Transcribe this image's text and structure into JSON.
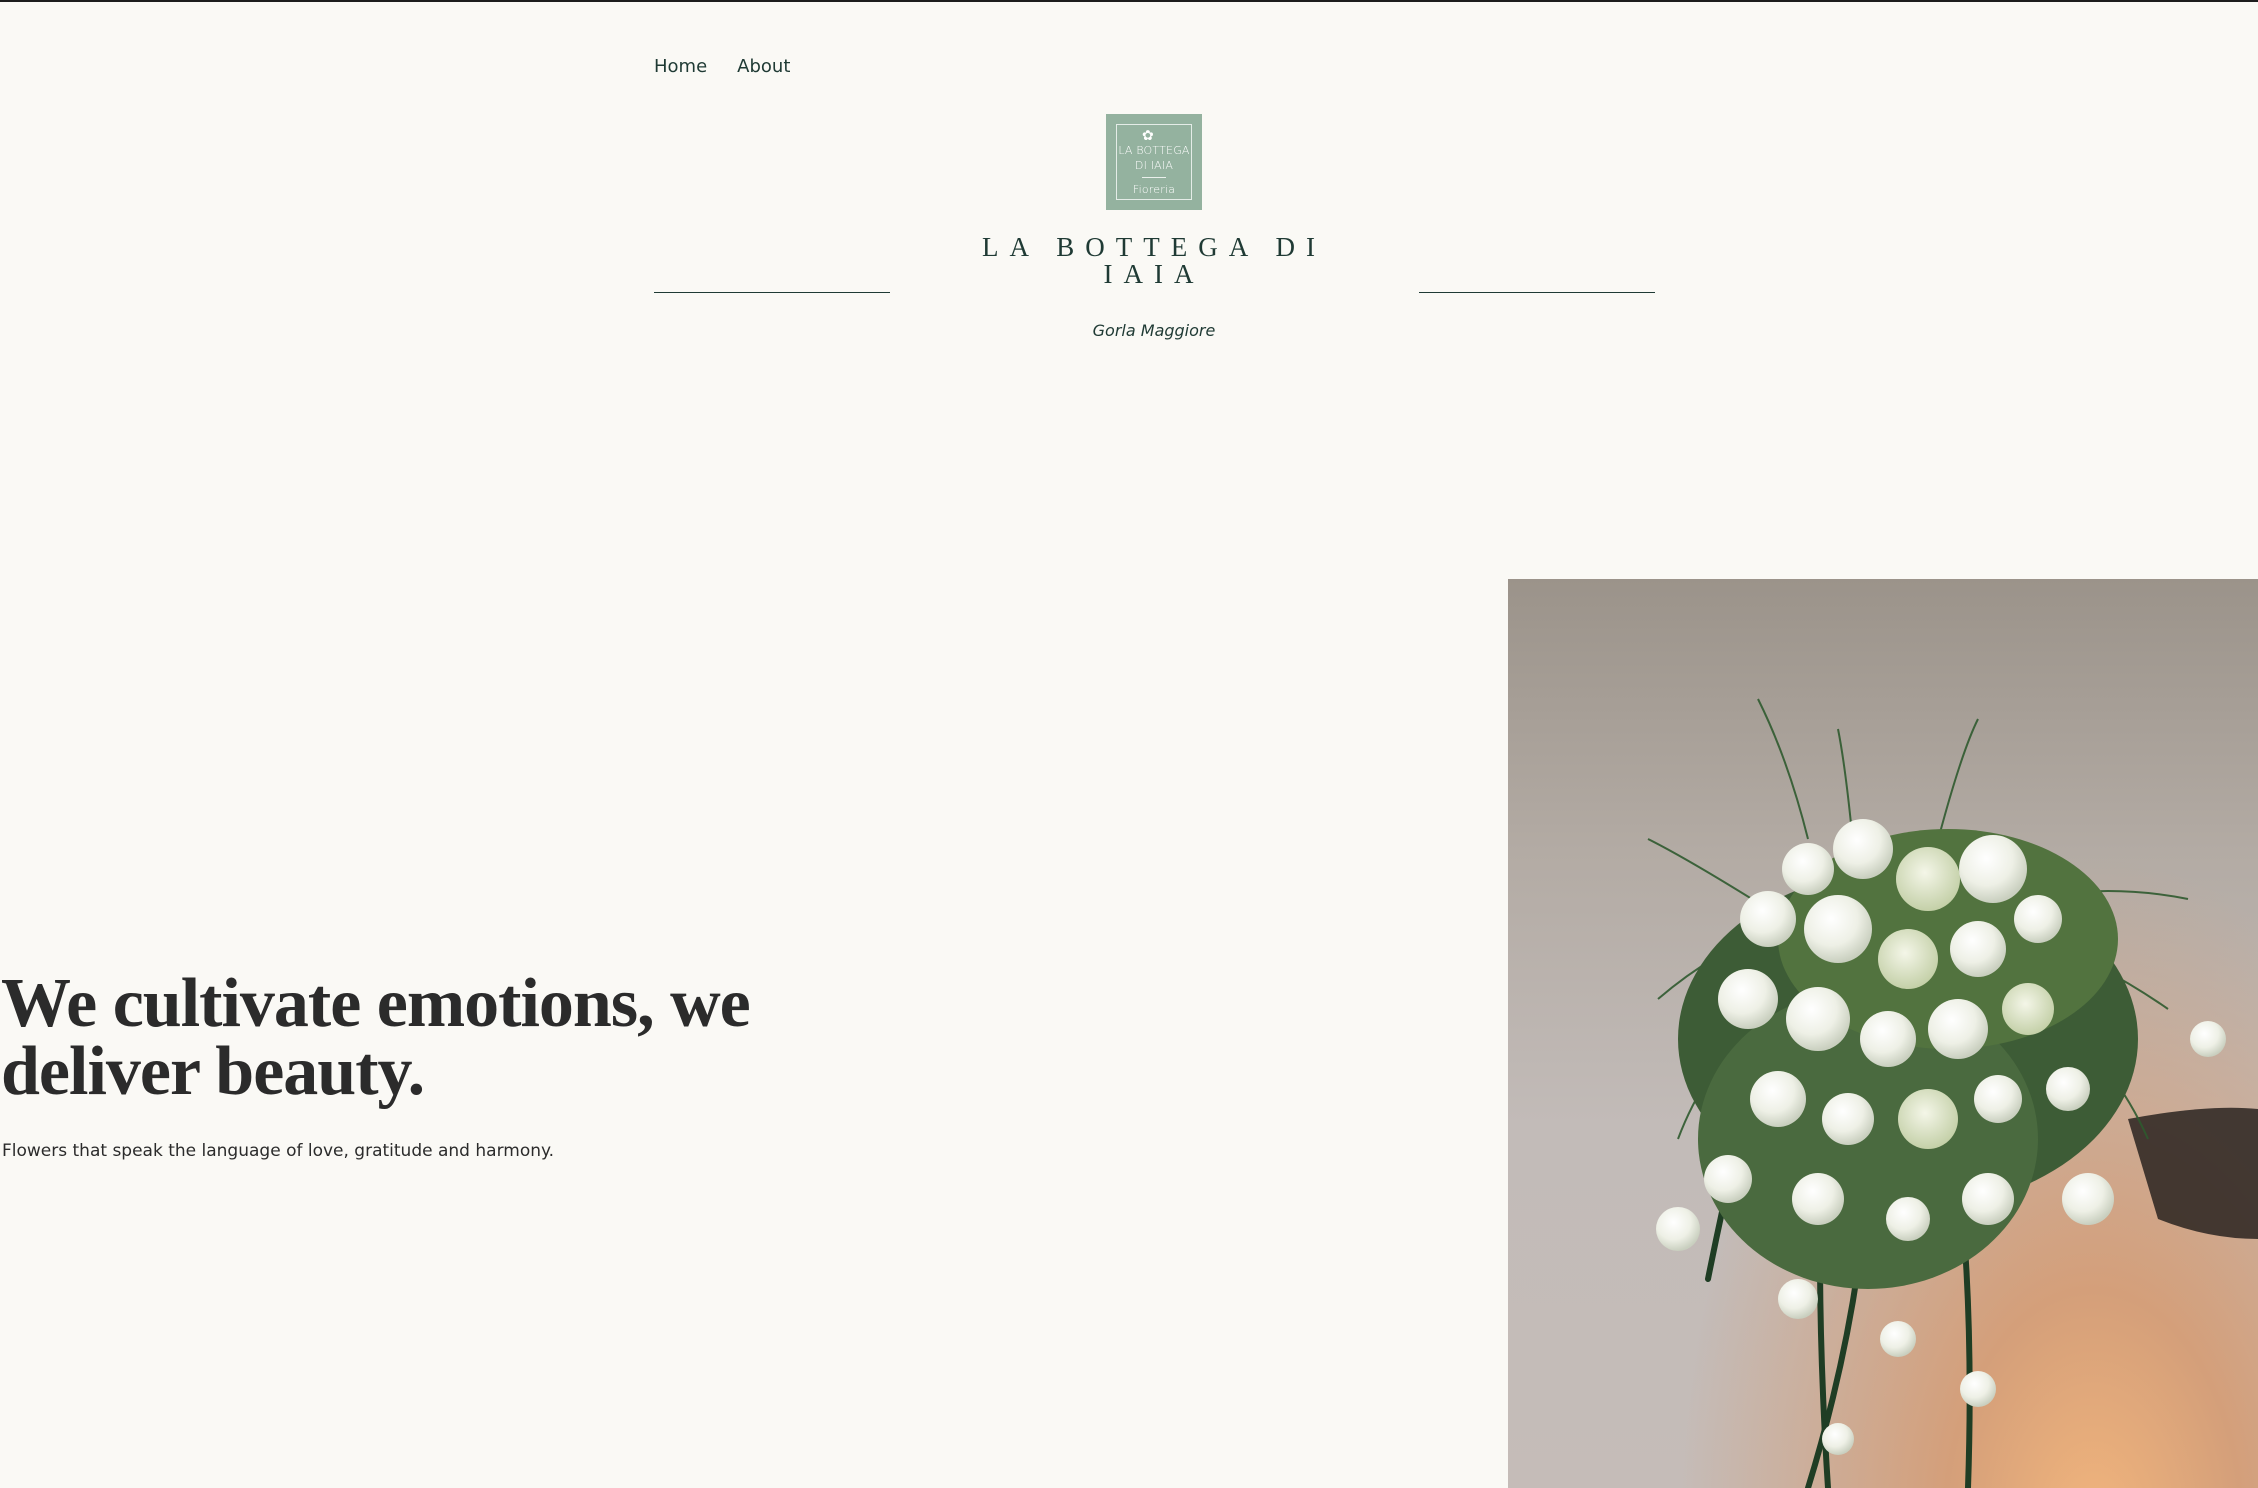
{
  "nav": {
    "items": [
      {
        "label": "Home"
      },
      {
        "label": "About"
      }
    ]
  },
  "logo": {
    "line1": "LA BOTTEGA",
    "line2": "DI IAIA",
    "sub": "Fioreria",
    "color": "#94b29f"
  },
  "site": {
    "title": "LA BOTTEGA DI IAIA",
    "tagline": "Gorla Maggiore"
  },
  "hero": {
    "heading": "We cultivate emotions, we deliver beauty.",
    "subheading": "Flowers that speak the language of love, gratitude and harmony.",
    "image": "white-flower-bouquet"
  },
  "colors": {
    "background": "#faf9f5",
    "accent_text": "#1f3a34",
    "heading_text": "#2b2b2b",
    "logo_green": "#94b29f"
  }
}
